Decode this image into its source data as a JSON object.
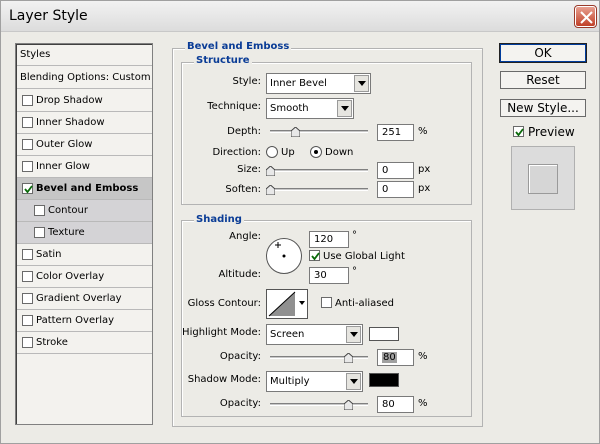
{
  "window": {
    "title": "Layer Style"
  },
  "styles_list": {
    "header": "Styles",
    "blending": "Blending Options: Custom",
    "items": [
      {
        "label": "Drop Shadow",
        "checked": false,
        "level": 0
      },
      {
        "label": "Inner Shadow",
        "checked": false,
        "level": 0
      },
      {
        "label": "Outer Glow",
        "checked": false,
        "level": 0
      },
      {
        "label": "Inner Glow",
        "checked": false,
        "level": 0
      },
      {
        "label": "Bevel and Emboss",
        "checked": true,
        "level": 0,
        "selected": true
      },
      {
        "label": "Contour",
        "checked": false,
        "level": 1
      },
      {
        "label": "Texture",
        "checked": false,
        "level": 1
      },
      {
        "label": "Satin",
        "checked": false,
        "level": 0
      },
      {
        "label": "Color Overlay",
        "checked": false,
        "level": 0
      },
      {
        "label": "Gradient Overlay",
        "checked": false,
        "level": 0
      },
      {
        "label": "Pattern Overlay",
        "checked": false,
        "level": 0
      },
      {
        "label": "Stroke",
        "checked": false,
        "level": 0
      }
    ]
  },
  "bevel": {
    "title": "Bevel and Emboss",
    "structure": {
      "title": "Structure",
      "style_label": "Style:",
      "style_value": "Inner Bevel",
      "technique_label": "Technique:",
      "technique_value": "Smooth",
      "depth_label": "Depth:",
      "depth_value": "251",
      "depth_unit": "%",
      "depth_fraction": 0.25,
      "direction_label": "Direction:",
      "direction_up": "Up",
      "direction_down": "Down",
      "size_label": "Size:",
      "size_value": "0",
      "size_unit": "px",
      "soften_label": "Soften:",
      "soften_value": "0",
      "soften_unit": "px"
    },
    "shading": {
      "title": "Shading",
      "angle_label": "Angle:",
      "angle_value": "120",
      "angle_unit": "°",
      "global_light_label": "Use Global Light",
      "altitude_label": "Altitude:",
      "altitude_value": "30",
      "altitude_unit": "°",
      "gloss_label": "Gloss Contour:",
      "anti_aliased_label": "Anti-aliased",
      "highlight_mode_label": "Highlight Mode:",
      "highlight_mode_value": "Screen",
      "highlight_color": "#ffffff",
      "highlight_opacity_label": "Opacity:",
      "highlight_opacity_value": "80",
      "highlight_opacity_unit": "%",
      "shadow_mode_label": "Shadow Mode:",
      "shadow_mode_value": "Multiply",
      "shadow_color": "#000000",
      "shadow_opacity_label": "Opacity:",
      "shadow_opacity_value": "80",
      "shadow_opacity_unit": "%"
    }
  },
  "buttons": {
    "ok": "OK",
    "reset": "Reset",
    "new_style": "New Style...",
    "preview": "Preview"
  },
  "colors": {
    "accent_title": "#0a3c96",
    "selected_row": "#c6c6c6"
  }
}
